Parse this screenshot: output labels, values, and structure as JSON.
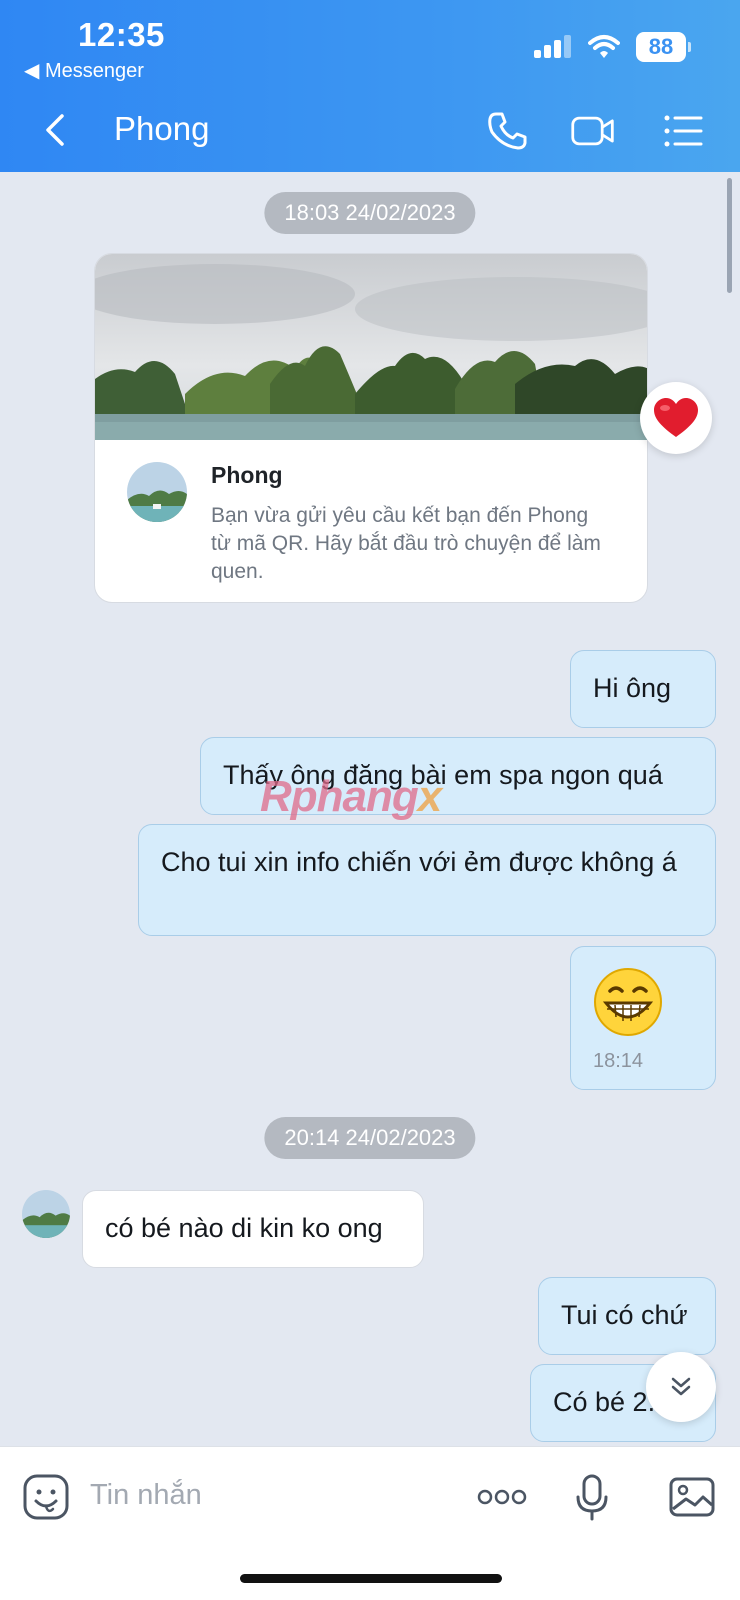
{
  "status_bar": {
    "time": "12:35",
    "back_app": "◀ Messenger",
    "battery": "88"
  },
  "header": {
    "title": "Phong"
  },
  "date_chips": [
    "18:03 24/02/2023",
    "20:14 24/02/2023"
  ],
  "friend_card": {
    "name": "Phong",
    "text": "Bạn vừa gửi yêu cầu kết bạn đến Phong từ mã QR. Hãy bắt đầu trò chuyện để làm quen."
  },
  "messages": [
    {
      "dir": "out",
      "text": "Hi ông"
    },
    {
      "dir": "out",
      "text": "Thấy ông đăng bài em spa ngon quá"
    },
    {
      "dir": "out",
      "text": "Cho tui xin info chiến với ẻm được không á"
    },
    {
      "dir": "out",
      "text": "",
      "time": "18:14",
      "sticker": "grinning-face"
    },
    {
      "dir": "in",
      "text": "có bé nào di kin ko ong"
    },
    {
      "dir": "out",
      "text": "Tui có chứ"
    },
    {
      "dir": "out",
      "text": "Có bé 2..."
    }
  ],
  "watermark": {
    "main": "Rphang",
    "suffix": "x"
  },
  "input": {
    "placeholder": "Tin nhắn"
  },
  "colors": {
    "header": "#3b92f2",
    "bubble_out": "#d6ecfb",
    "background": "#e3e8f1"
  }
}
